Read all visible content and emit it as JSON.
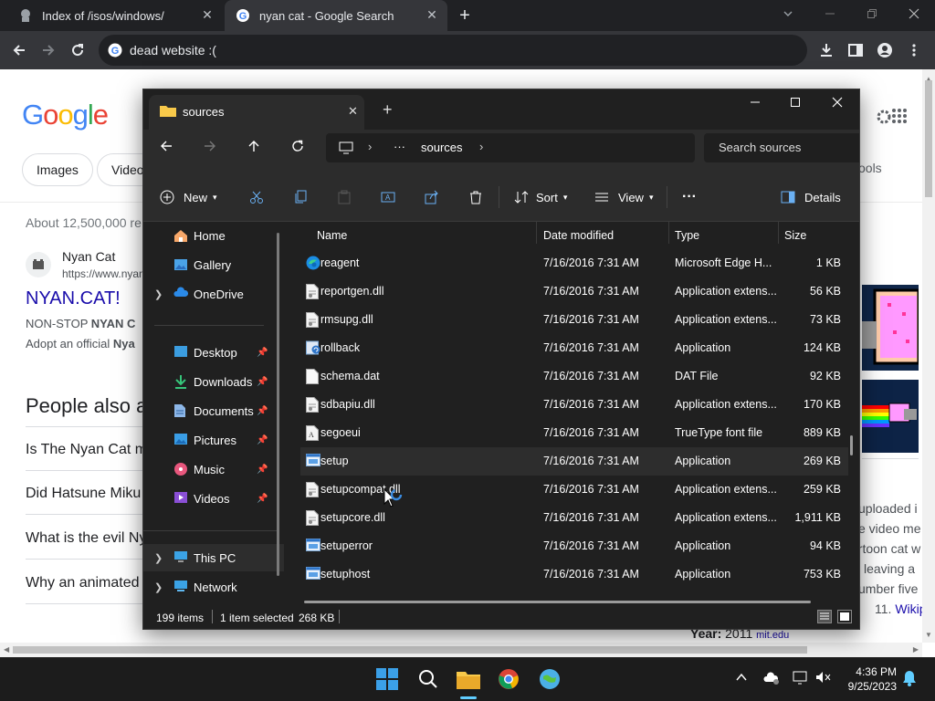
{
  "browser": {
    "tabs": [
      {
        "title": "Index of /isos/windows/",
        "active": false
      },
      {
        "title": "nyan cat - Google Search",
        "active": true
      }
    ],
    "omnibox_text": "dead website :("
  },
  "google": {
    "logo": "Google",
    "chips": [
      "Images",
      "Video"
    ],
    "right_chip_fragment": "ools",
    "result_count": "About 12,500,000 re",
    "result": {
      "site_name": "Nyan Cat",
      "url": "https://www.nyan",
      "title": "NYAN.CAT!",
      "snippet_line1_prefix": "NON-STOP ",
      "snippet_line1_bold": "NYAN C",
      "snippet_line2_prefix": "Adopt an official ",
      "snippet_line2_bold": "Nya"
    },
    "paa_title": "People also a",
    "paa_questions": [
      "Is The Nyan Cat m",
      "Did Hatsune Miku",
      "What is the evil Ny",
      "Why an animated"
    ],
    "kp_text": [
      "uploaded i",
      "e video me",
      "artoon cat w",
      "leaving a",
      "umber five",
      "11."
    ],
    "kp_link": "Wikipec",
    "kp_year_label": "Year:",
    "kp_year_value": "2011",
    "kp_year_source": "mit.edu"
  },
  "explorer": {
    "tab_title": "sources",
    "breadcrumb": {
      "ellipsis": "···",
      "current": "sources"
    },
    "search_placeholder": "Search sources",
    "toolbar": {
      "new": "New",
      "sort": "Sort",
      "view": "View",
      "more": "···",
      "details": "Details"
    },
    "nav": {
      "home": "Home",
      "gallery": "Gallery",
      "onedrive": "OneDrive",
      "desktop": "Desktop",
      "downloads": "Downloads",
      "documents": "Documents",
      "pictures": "Pictures",
      "music": "Music",
      "videos": "Videos",
      "this_pc": "This PC",
      "network": "Network"
    },
    "columns": {
      "name": "Name",
      "date": "Date modified",
      "type": "Type",
      "size": "Size"
    },
    "files": [
      {
        "name": "reagent",
        "date": "7/16/2016 7:31 AM",
        "type": "Microsoft Edge H...",
        "size": "1 KB",
        "icon": "edge-icon"
      },
      {
        "name": "reportgen.dll",
        "date": "7/16/2016 7:31 AM",
        "type": "Application extens...",
        "size": "56 KB",
        "icon": "dll-file-icon"
      },
      {
        "name": "rmsupg.dll",
        "date": "7/16/2016 7:31 AM",
        "type": "Application extens...",
        "size": "73 KB",
        "icon": "dll-file-icon"
      },
      {
        "name": "rollback",
        "date": "7/16/2016 7:31 AM",
        "type": "Application",
        "size": "124 KB",
        "icon": "rollback-app-icon"
      },
      {
        "name": "schema.dat",
        "date": "7/16/2016 7:31 AM",
        "type": "DAT File",
        "size": "92 KB",
        "icon": "blank-file-icon"
      },
      {
        "name": "sdbapiu.dll",
        "date": "7/16/2016 7:31 AM",
        "type": "Application extens...",
        "size": "170 KB",
        "icon": "dll-file-icon"
      },
      {
        "name": "segoeui",
        "date": "7/16/2016 7:31 AM",
        "type": "TrueType font file",
        "size": "889 KB",
        "icon": "font-file-icon"
      },
      {
        "name": "setup",
        "date": "7/16/2016 7:31 AM",
        "type": "Application",
        "size": "269 KB",
        "icon": "app-icon"
      },
      {
        "name": "setupcompat.dll",
        "date": "7/16/2016 7:31 AM",
        "type": "Application extens...",
        "size": "259 KB",
        "icon": "dll-file-icon"
      },
      {
        "name": "setupcore.dll",
        "date": "7/16/2016 7:31 AM",
        "type": "Application extens...",
        "size": "1,911 KB",
        "icon": "dll-file-icon"
      },
      {
        "name": "setuperror",
        "date": "7/16/2016 7:31 AM",
        "type": "Application",
        "size": "94 KB",
        "icon": "app-icon"
      },
      {
        "name": "setuphost",
        "date": "7/16/2016 7:31 AM",
        "type": "Application",
        "size": "753 KB",
        "icon": "app-icon"
      }
    ],
    "selected_index": 7,
    "status": {
      "count": "199 items",
      "selection": "1 item selected",
      "size": "268 KB"
    }
  },
  "taskbar": {
    "time": "4:36 PM",
    "date": "9/25/2023"
  }
}
